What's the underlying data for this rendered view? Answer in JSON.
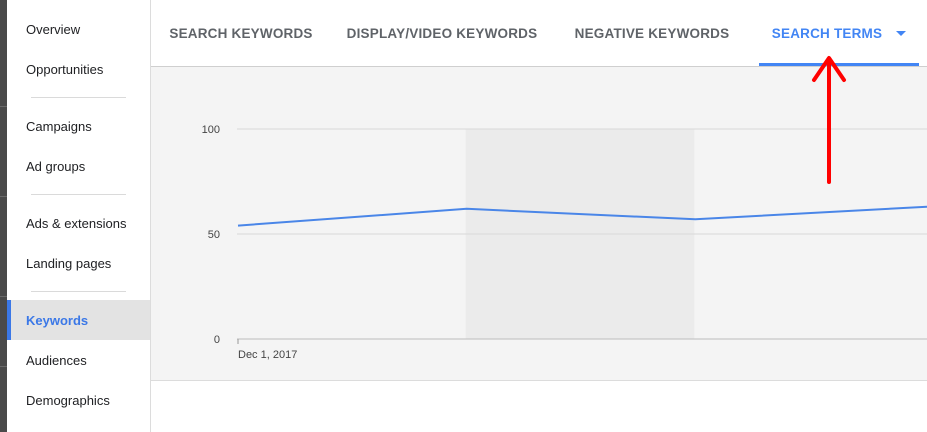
{
  "sidebar": {
    "items": [
      {
        "label": "Overview"
      },
      {
        "label": "Opportunities"
      },
      {
        "label": "Campaigns"
      },
      {
        "label": "Ad groups"
      },
      {
        "label": "Ads & extensions"
      },
      {
        "label": "Landing pages"
      },
      {
        "label": "Keywords"
      },
      {
        "label": "Audiences"
      },
      {
        "label": "Demographics"
      }
    ],
    "active_item": "Keywords"
  },
  "tabs": [
    {
      "label": "SEARCH KEYWORDS"
    },
    {
      "label": "DISPLAY/VIDEO KEYWORDS"
    },
    {
      "label": "NEGATIVE KEYWORDS"
    },
    {
      "label": "SEARCH TERMS"
    }
  ],
  "active_tab": "SEARCH TERMS",
  "chart_data": {
    "type": "line",
    "title": "",
    "xlabel": "",
    "ylabel": "",
    "ylim": [
      0,
      100
    ],
    "yticks": [
      0,
      50,
      100
    ],
    "x_start_label": "Dec 1, 2017",
    "grid": true,
    "series": [
      {
        "values": [
          54,
          62,
          57,
          63
        ]
      }
    ],
    "shaded_period_index": 1,
    "colors": {
      "line": "#4a86e8",
      "shade": "#ebebeb",
      "grid": "#d8d8d8"
    }
  },
  "annotation": {
    "type": "arrow",
    "color": "#ff0000",
    "points_to": "SEARCH TERMS"
  }
}
